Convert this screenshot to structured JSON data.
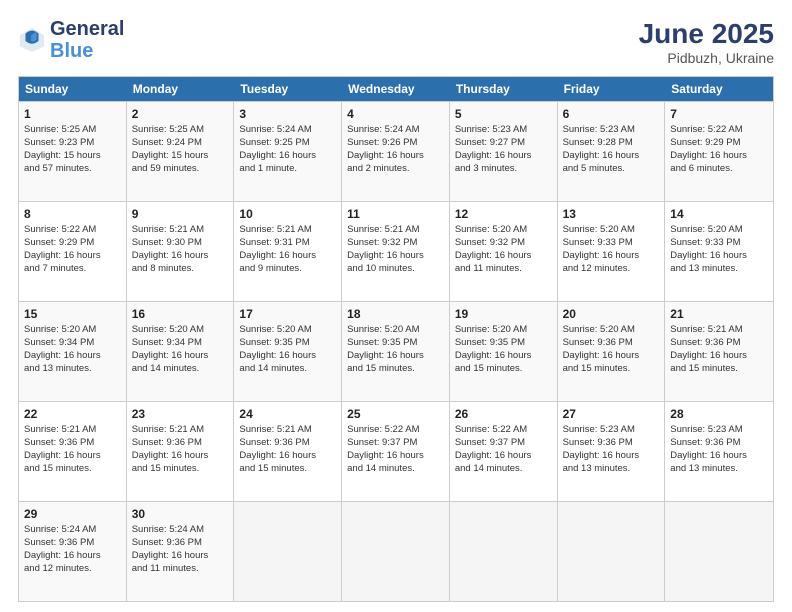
{
  "header": {
    "logo_line1": "General",
    "logo_line2": "Blue",
    "title": "June 2025",
    "subtitle": "Pidbuzh, Ukraine"
  },
  "calendar": {
    "days_of_week": [
      "Sunday",
      "Monday",
      "Tuesday",
      "Wednesday",
      "Thursday",
      "Friday",
      "Saturday"
    ],
    "rows": [
      [
        {
          "day": "1",
          "info": "Sunrise: 5:25 AM\nSunset: 9:23 PM\nDaylight: 15 hours\nand 57 minutes."
        },
        {
          "day": "2",
          "info": "Sunrise: 5:25 AM\nSunset: 9:24 PM\nDaylight: 15 hours\nand 59 minutes."
        },
        {
          "day": "3",
          "info": "Sunrise: 5:24 AM\nSunset: 9:25 PM\nDaylight: 16 hours\nand 1 minute."
        },
        {
          "day": "4",
          "info": "Sunrise: 5:24 AM\nSunset: 9:26 PM\nDaylight: 16 hours\nand 2 minutes."
        },
        {
          "day": "5",
          "info": "Sunrise: 5:23 AM\nSunset: 9:27 PM\nDaylight: 16 hours\nand 3 minutes."
        },
        {
          "day": "6",
          "info": "Sunrise: 5:23 AM\nSunset: 9:28 PM\nDaylight: 16 hours\nand 5 minutes."
        },
        {
          "day": "7",
          "info": "Sunrise: 5:22 AM\nSunset: 9:29 PM\nDaylight: 16 hours\nand 6 minutes."
        }
      ],
      [
        {
          "day": "8",
          "info": "Sunrise: 5:22 AM\nSunset: 9:29 PM\nDaylight: 16 hours\nand 7 minutes."
        },
        {
          "day": "9",
          "info": "Sunrise: 5:21 AM\nSunset: 9:30 PM\nDaylight: 16 hours\nand 8 minutes."
        },
        {
          "day": "10",
          "info": "Sunrise: 5:21 AM\nSunset: 9:31 PM\nDaylight: 16 hours\nand 9 minutes."
        },
        {
          "day": "11",
          "info": "Sunrise: 5:21 AM\nSunset: 9:32 PM\nDaylight: 16 hours\nand 10 minutes."
        },
        {
          "day": "12",
          "info": "Sunrise: 5:20 AM\nSunset: 9:32 PM\nDaylight: 16 hours\nand 11 minutes."
        },
        {
          "day": "13",
          "info": "Sunrise: 5:20 AM\nSunset: 9:33 PM\nDaylight: 16 hours\nand 12 minutes."
        },
        {
          "day": "14",
          "info": "Sunrise: 5:20 AM\nSunset: 9:33 PM\nDaylight: 16 hours\nand 13 minutes."
        }
      ],
      [
        {
          "day": "15",
          "info": "Sunrise: 5:20 AM\nSunset: 9:34 PM\nDaylight: 16 hours\nand 13 minutes."
        },
        {
          "day": "16",
          "info": "Sunrise: 5:20 AM\nSunset: 9:34 PM\nDaylight: 16 hours\nand 14 minutes."
        },
        {
          "day": "17",
          "info": "Sunrise: 5:20 AM\nSunset: 9:35 PM\nDaylight: 16 hours\nand 14 minutes."
        },
        {
          "day": "18",
          "info": "Sunrise: 5:20 AM\nSunset: 9:35 PM\nDaylight: 16 hours\nand 15 minutes."
        },
        {
          "day": "19",
          "info": "Sunrise: 5:20 AM\nSunset: 9:35 PM\nDaylight: 16 hours\nand 15 minutes."
        },
        {
          "day": "20",
          "info": "Sunrise: 5:20 AM\nSunset: 9:36 PM\nDaylight: 16 hours\nand 15 minutes."
        },
        {
          "day": "21",
          "info": "Sunrise: 5:21 AM\nSunset: 9:36 PM\nDaylight: 16 hours\nand 15 minutes."
        }
      ],
      [
        {
          "day": "22",
          "info": "Sunrise: 5:21 AM\nSunset: 9:36 PM\nDaylight: 16 hours\nand 15 minutes."
        },
        {
          "day": "23",
          "info": "Sunrise: 5:21 AM\nSunset: 9:36 PM\nDaylight: 16 hours\nand 15 minutes."
        },
        {
          "day": "24",
          "info": "Sunrise: 5:21 AM\nSunset: 9:36 PM\nDaylight: 16 hours\nand 15 minutes."
        },
        {
          "day": "25",
          "info": "Sunrise: 5:22 AM\nSunset: 9:37 PM\nDaylight: 16 hours\nand 14 minutes."
        },
        {
          "day": "26",
          "info": "Sunrise: 5:22 AM\nSunset: 9:37 PM\nDaylight: 16 hours\nand 14 minutes."
        },
        {
          "day": "27",
          "info": "Sunrise: 5:23 AM\nSunset: 9:36 PM\nDaylight: 16 hours\nand 13 minutes."
        },
        {
          "day": "28",
          "info": "Sunrise: 5:23 AM\nSunset: 9:36 PM\nDaylight: 16 hours\nand 13 minutes."
        }
      ],
      [
        {
          "day": "29",
          "info": "Sunrise: 5:24 AM\nSunset: 9:36 PM\nDaylight: 16 hours\nand 12 minutes."
        },
        {
          "day": "30",
          "info": "Sunrise: 5:24 AM\nSunset: 9:36 PM\nDaylight: 16 hours\nand 11 minutes."
        },
        {
          "day": "",
          "info": ""
        },
        {
          "day": "",
          "info": ""
        },
        {
          "day": "",
          "info": ""
        },
        {
          "day": "",
          "info": ""
        },
        {
          "day": "",
          "info": ""
        }
      ]
    ]
  }
}
